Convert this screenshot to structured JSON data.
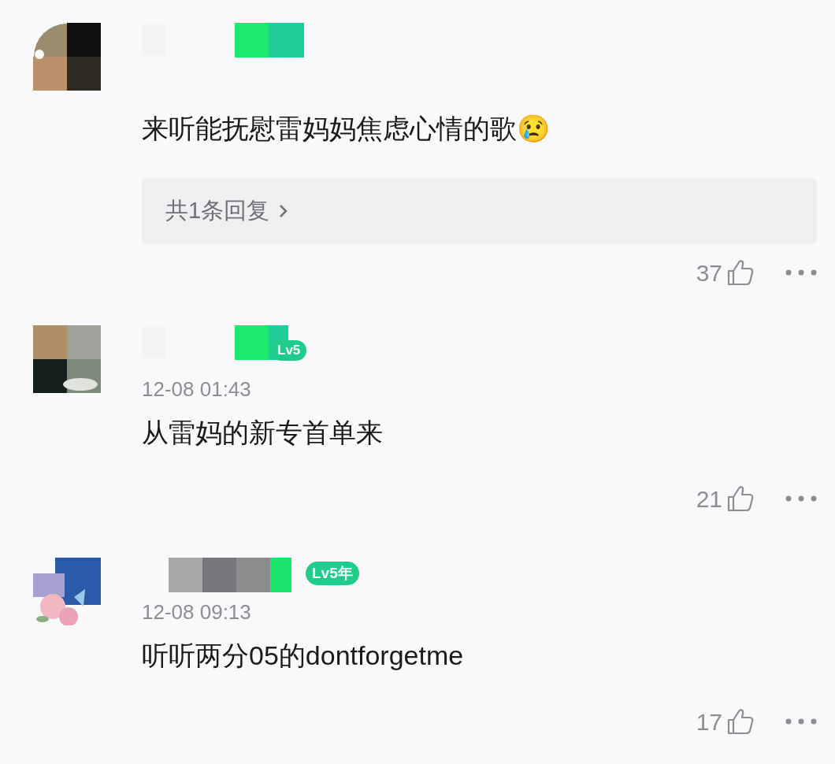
{
  "comments": [
    {
      "text": "来听能抚慰雷妈妈焦虑心情的歌😢",
      "replies": "共1条回复",
      "likes": "37"
    },
    {
      "badge": "Lv5",
      "time": "12-08 01:43",
      "text": "从雷妈的新专首单来",
      "likes": "21"
    },
    {
      "badge": "Lv5年",
      "time": "12-08 09:13",
      "text": "听听两分05的dontforgetme",
      "likes": "17"
    }
  ]
}
